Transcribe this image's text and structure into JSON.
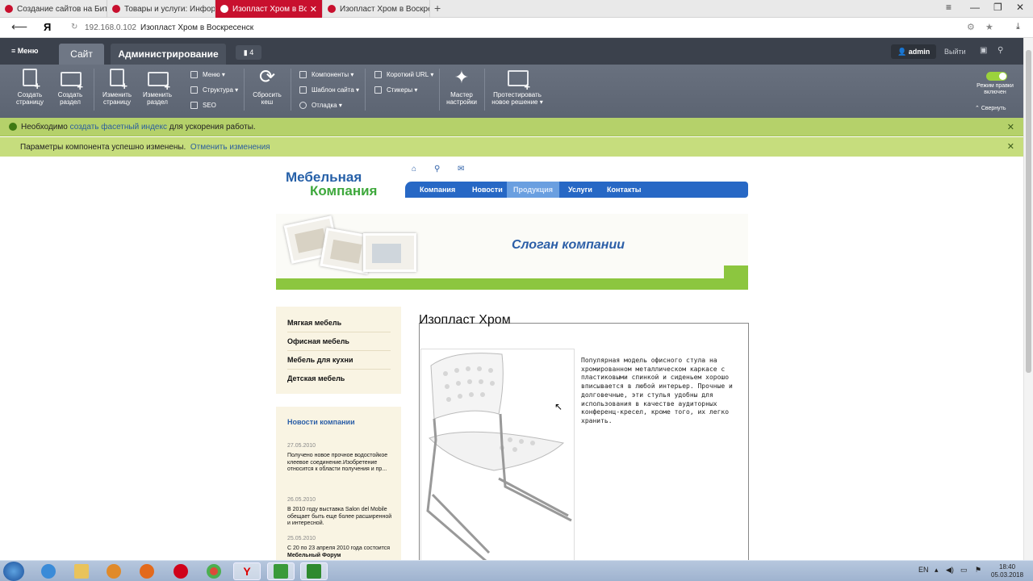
{
  "browser": {
    "tabs": [
      {
        "label": "Создание сайтов на Битрикс",
        "active": false
      },
      {
        "label": "Товары и услуги: Информаци",
        "active": false
      },
      {
        "label": "Изопласт Хром в Воскресенск",
        "active": true
      },
      {
        "label": "Изопласт Хром в Воскресенск",
        "active": false
      }
    ],
    "new_tab": "+",
    "address": "192.168.0.102",
    "page_title": "Изопласт Хром в Воскресенск",
    "window_controls": [
      "≡",
      "—",
      "❐",
      "✕"
    ]
  },
  "admin": {
    "menu": "Меню",
    "tab_site": "Сайт",
    "tab_admin": "Администрирование",
    "notif_count": "4",
    "user": "admin",
    "logout": "Выйти",
    "buttons": {
      "create_page": [
        "Создать",
        "страницу"
      ],
      "create_section": [
        "Создать",
        "раздел"
      ],
      "edit_page": [
        "Изменить",
        "страницу"
      ],
      "edit_section": [
        "Изменить",
        "раздел"
      ],
      "reset_cache": [
        "Сбросить",
        "кеш"
      ],
      "wizard": [
        "Мастер",
        "настройки"
      ],
      "test_solution": [
        "Протестировать",
        "новое решение"
      ]
    },
    "small": {
      "menu": "Меню",
      "structure": "Структура",
      "seo": "SEO",
      "components": "Компоненты",
      "template": "Шаблон сайта",
      "debug": "Отладка",
      "short_url": "Короткий URL",
      "stickers": "Стикеры"
    },
    "edit_mode": [
      "Режим правки",
      "включен"
    ],
    "collapse": "Свернуть"
  },
  "alerts": {
    "a1_pre": "Необходимо",
    "a1_link": "создать фасетный индекс",
    "a1_post": "для ускорения работы.",
    "a2_text": "Параметры компонента успешно изменены.",
    "a2_link": "Отменить изменения",
    "close": "✕"
  },
  "site": {
    "logo_line1": "Мебельная",
    "logo_line2": "Компания",
    "nav": [
      "Компания",
      "Новости",
      "Продукция",
      "Услуги",
      "Контакты"
    ],
    "nav_active": "Продукция",
    "slogan": "Слоган компании",
    "sidebar": [
      "Мягкая мебель",
      "Офисная мебель",
      "Мебель для кухни",
      "Детская мебель"
    ],
    "news_title": "Новости компании",
    "news": [
      {
        "date": "27.05.2010",
        "text": "Получено новое прочное водостойкое клеевое соединение.Изобретение относится к области получения и пр..."
      },
      {
        "date": "26.05.2010",
        "text": "В 2010 году выставка Salon del Mobile обещает быть еще более расширенной и интересной."
      },
      {
        "date": "25.05.2010",
        "text": "С 20 по 23 апреля 2010 года состоится",
        "bold": "Мебельный Форум"
      }
    ],
    "product_title": "Изопласт Хром",
    "product_desc": "Популярная модель офисного стула на хромированном металлическом каркасе с пластиковыми спинкой и сиденьем хорошо вписывается в любой интерьер. Прочные и долговечные, эти стулья удобны для использования в качестве аудиторных конференц-кресел, кроме того, их легко хранить."
  },
  "taskbar": {
    "lang": "EN",
    "time": "18:40",
    "date": "05.03.2018"
  },
  "colors": {
    "accent": "#2768c5",
    "green": "#8cc63f",
    "browser_red": "#c8102e",
    "admin_bg": "#5c6472"
  }
}
